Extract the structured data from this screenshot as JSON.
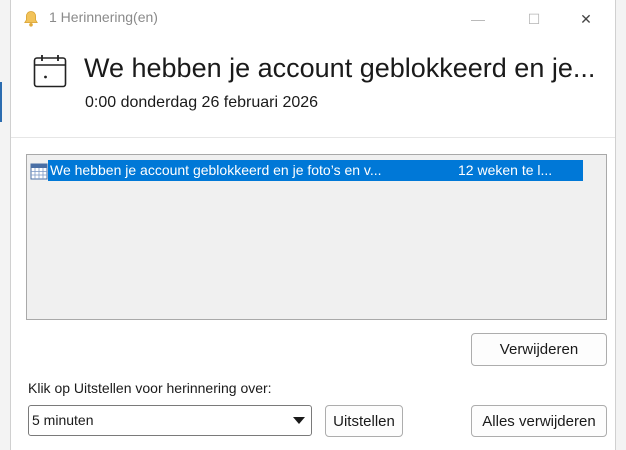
{
  "window": {
    "title": "1 Herinnering(en)",
    "title_icon": "bell-icon",
    "controls": {
      "minimize": "—",
      "maximize": "☐",
      "close": "✕"
    }
  },
  "header": {
    "icon": "calendar-icon",
    "title": "We hebben je account geblokkeerd en je...",
    "subtitle": "0:00 donderdag 26 februari 2026"
  },
  "reminders": [
    {
      "icon": "calendar-grid-icon",
      "subject": "We hebben je account geblokkeerd en je foto’s en v...",
      "due": "12 weken te l...",
      "selected": true
    }
  ],
  "buttons": {
    "remove_label": "Verwijderen",
    "snooze_label": "Uitstellen",
    "remove_all_label": "Alles verwijderen"
  },
  "snooze": {
    "prompt": "Klik op Uitstellen voor herinnering over:",
    "selected_option": "5 minuten"
  },
  "colors": {
    "selection": "#0078d7",
    "selection_text": "#ffffff",
    "list_background": "#f0f0f0"
  }
}
